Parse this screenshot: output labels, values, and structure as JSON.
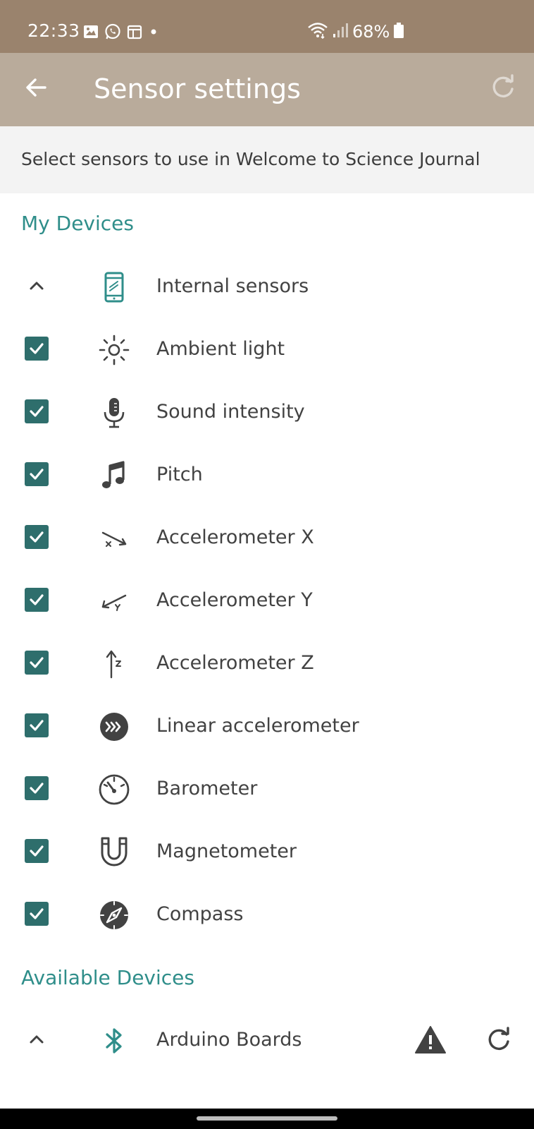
{
  "status_bar": {
    "time": "22:33",
    "battery": "68%",
    "notification_icons": [
      "image-icon",
      "whatsapp-icon",
      "calendar-icon",
      "dot-icon"
    ],
    "bg_color": "#9a836d"
  },
  "app_bar": {
    "title": "Sensor settings",
    "bg_color": "#b9ab9b"
  },
  "subtitle": "Select sensors to use in Welcome to Science Journal",
  "accent_color": "#2f8e8a",
  "checkbox_color": "#2e6e6c",
  "my_devices": {
    "header": "My Devices",
    "group": {
      "label": "Internal sensors",
      "expanded": true,
      "icon": "phone-icon"
    },
    "sensors": [
      {
        "label": "Ambient light",
        "checked": true,
        "icon": "sun-icon"
      },
      {
        "label": "Sound intensity",
        "checked": true,
        "icon": "microphone-icon"
      },
      {
        "label": "Pitch",
        "checked": true,
        "icon": "music-note-icon"
      },
      {
        "label": "Accelerometer X",
        "checked": true,
        "icon": "accel-x-icon"
      },
      {
        "label": "Accelerometer Y",
        "checked": true,
        "icon": "accel-y-icon"
      },
      {
        "label": "Accelerometer Z",
        "checked": true,
        "icon": "accel-z-icon"
      },
      {
        "label": "Linear accelerometer",
        "checked": true,
        "icon": "linear-accel-icon"
      },
      {
        "label": "Barometer",
        "checked": true,
        "icon": "barometer-icon"
      },
      {
        "label": "Magnetometer",
        "checked": true,
        "icon": "magnet-icon"
      },
      {
        "label": "Compass",
        "checked": true,
        "icon": "compass-icon"
      }
    ]
  },
  "available_devices": {
    "header": "Available Devices",
    "group": {
      "label": "Arduino Boards",
      "expanded": true,
      "icon": "bluetooth-icon"
    }
  }
}
